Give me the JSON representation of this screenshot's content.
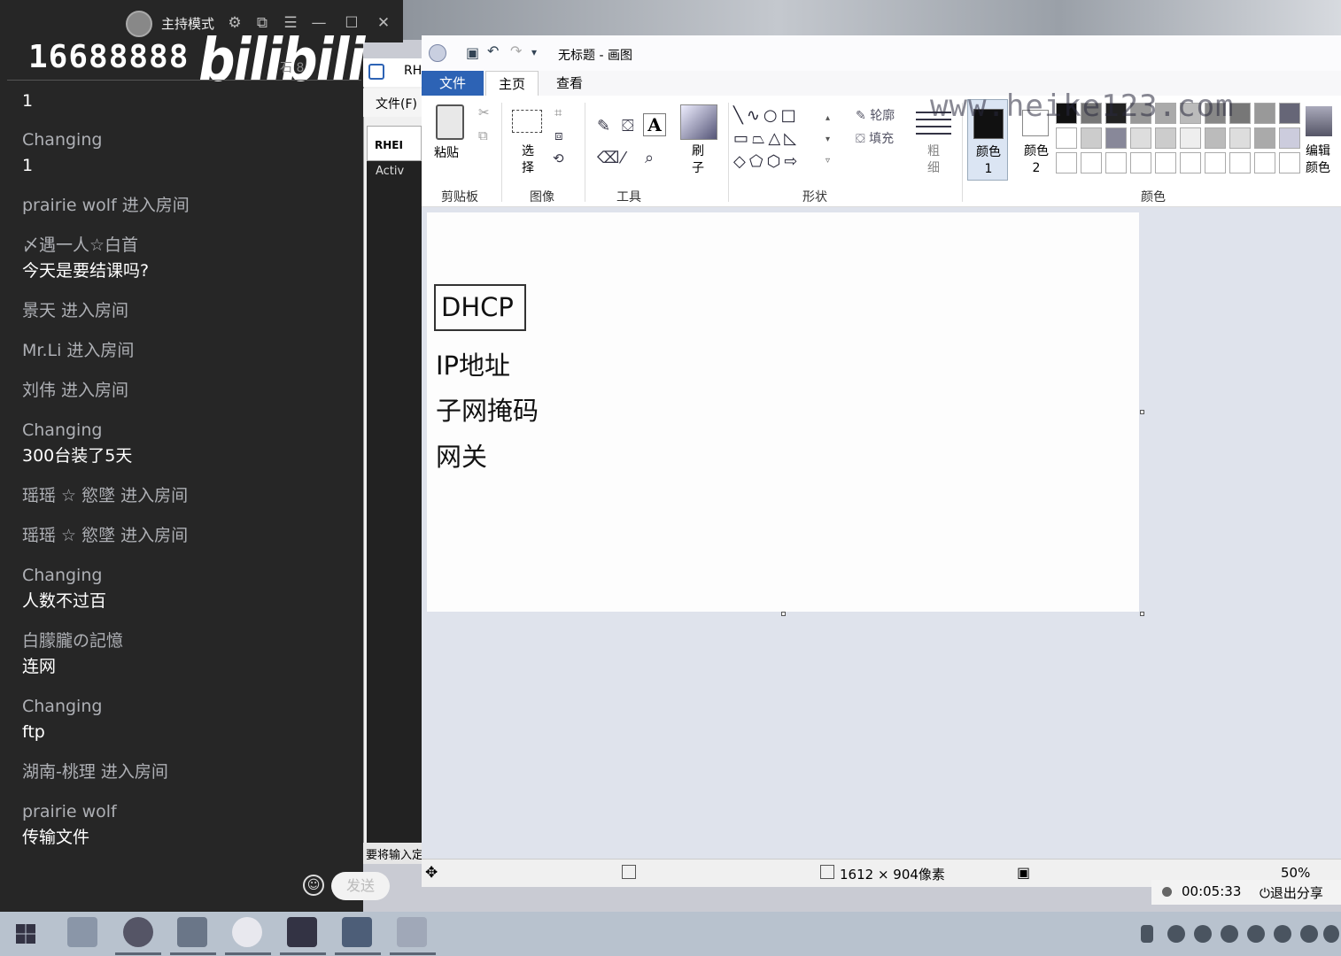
{
  "header": {
    "host_mode": "主持模式",
    "room_id": "16688888",
    "logo": "bilibili",
    "logo_sub": "石 8"
  },
  "chat": {
    "messages": [
      {
        "name": "",
        "text": "1"
      },
      {
        "name": "Changing",
        "text": "1"
      },
      {
        "name": "prairie wolf 进入房间",
        "text": ""
      },
      {
        "name": "〆遇一人☆白首",
        "text": "今天是要结课吗?"
      },
      {
        "name": "景天 进入房间",
        "text": ""
      },
      {
        "name": "Mr.Li 进入房间",
        "text": ""
      },
      {
        "name": "刘伟 进入房间",
        "text": ""
      },
      {
        "name": "Changing",
        "text": "300台装了5天"
      },
      {
        "name": "瑶瑶 ☆ 慾墜 进入房间",
        "text": ""
      },
      {
        "name": "瑶瑶 ☆ 慾墜 进入房间",
        "text": ""
      },
      {
        "name": "Changing",
        "text": "人数不过百"
      },
      {
        "name": "白朦朧の記憶",
        "text": "连网"
      },
      {
        "name": "Changing",
        "text": "ftp"
      },
      {
        "name": "湖南-桃理 进入房间",
        "text": ""
      },
      {
        "name": "prairie wolf",
        "text": "传输文件"
      }
    ],
    "send_label": "发送"
  },
  "mid_window": {
    "title": "RH",
    "menu_file": "文件(F)",
    "tab_label": "RHEI",
    "tree_item": "Activ",
    "status": "要将输入定"
  },
  "paint": {
    "title": "无标题 - 画图",
    "tabs": {
      "file": "文件",
      "home": "主页",
      "view": "查看"
    },
    "ribbon": {
      "paste": "粘贴",
      "select": "选择",
      "brush": "刷子",
      "outline": "轮廓",
      "fill": "填充",
      "size": "粗细",
      "color1": "颜色 1",
      "color2": "颜色 2",
      "edit_colors": "编辑颜色",
      "groups": {
        "clipboard": "剪贴板",
        "image": "图像",
        "tools": "工具",
        "shapes": "形状",
        "colors": "颜色"
      }
    },
    "watermark": "www.heike123.com",
    "canvas_text": {
      "dhcp": "DHCP",
      "ip": "IP地址",
      "mask": "子网掩码",
      "gateway": "网关"
    },
    "status": {
      "dimensions": "1612 × 904像素",
      "zoom": "50%"
    }
  },
  "recording": {
    "time": "00:05:33",
    "exit": "退出分享"
  },
  "colors": {
    "chat_bg": "#262626",
    "paint_file_tab": "#2d63b5",
    "taskbar": "#b8c2ce"
  }
}
